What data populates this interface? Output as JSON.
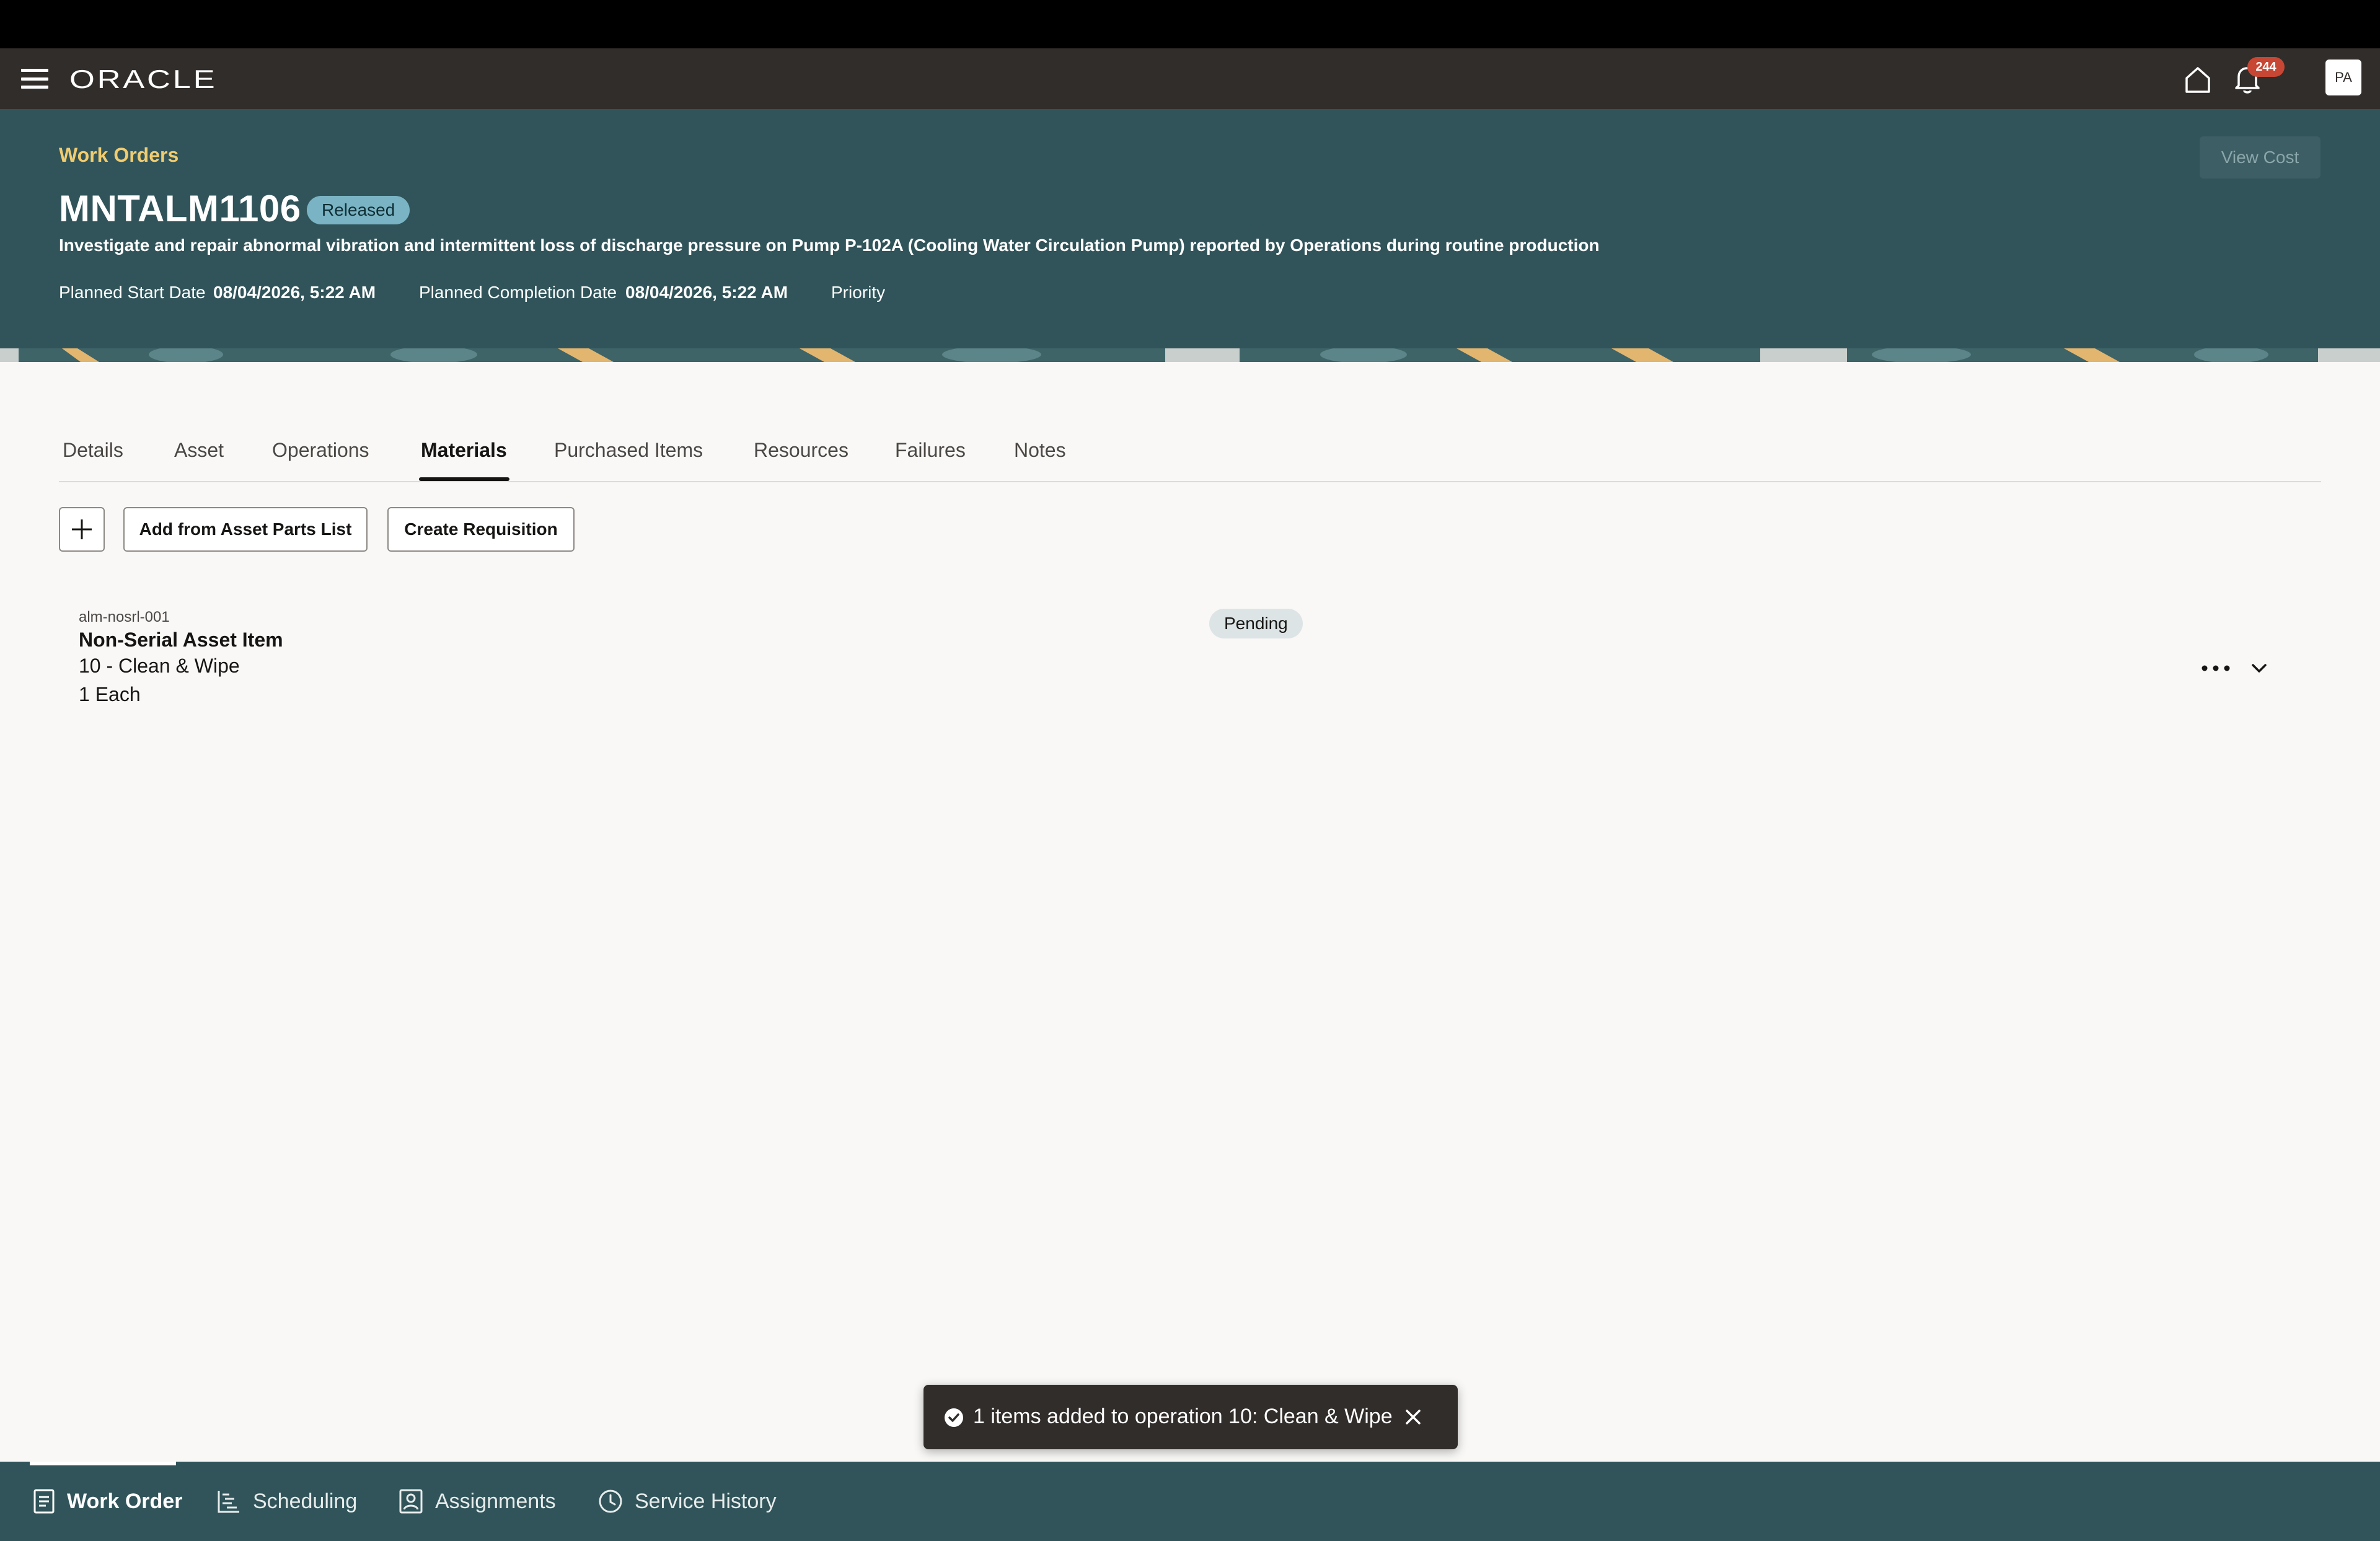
{
  "app": {
    "logo": "ORACLE",
    "notification_count": "244",
    "user_initials": "PA"
  },
  "header": {
    "breadcrumb": "Work Orders",
    "view_cost_label": "View Cost",
    "work_order_number": "MNTALM1106",
    "status": "Released",
    "description": "Investigate and repair abnormal vibration and intermittent loss of discharge pressure on Pump P-102A (Cooling Water Circulation Pump) reported by Operations during routine production",
    "planned_start_label": "Planned Start Date",
    "planned_start_value": "08/04/2026, 5:22 AM",
    "planned_completion_label": "Planned Completion Date",
    "planned_completion_value": "08/04/2026, 5:22 AM",
    "priority_label": "Priority"
  },
  "tabs": [
    {
      "label": "Details"
    },
    {
      "label": "Asset"
    },
    {
      "label": "Operations"
    },
    {
      "label": "Materials",
      "active": true
    },
    {
      "label": "Purchased Items"
    },
    {
      "label": "Resources"
    },
    {
      "label": "Failures"
    },
    {
      "label": "Notes"
    }
  ],
  "toolbar": {
    "add_icon": "plus-icon",
    "add_from_parts_label": "Add from Asset Parts List",
    "create_requisition_label": "Create Requisition"
  },
  "materials": [
    {
      "code": "alm-nosrl-001",
      "name": "Non-Serial Asset Item",
      "operation": "10 - Clean & Wipe",
      "quantity": "1 Each",
      "status": "Pending"
    }
  ],
  "toast": {
    "message": "1 items added to operation 10: Clean & Wipe",
    "icon": "check-circle-icon"
  },
  "bottom_nav": [
    {
      "label": "Work Order",
      "icon": "document-icon",
      "active": true
    },
    {
      "label": "Scheduling",
      "icon": "schedule-icon"
    },
    {
      "label": "Assignments",
      "icon": "person-icon"
    },
    {
      "label": "Service History",
      "icon": "clock-icon"
    }
  ],
  "colors": {
    "header_bg": "#30545a",
    "appbar_bg": "#312d2a",
    "breadcrumb": "#f0cc71",
    "released_badge": "#7ab4c4",
    "notification_badge": "#c74634"
  }
}
